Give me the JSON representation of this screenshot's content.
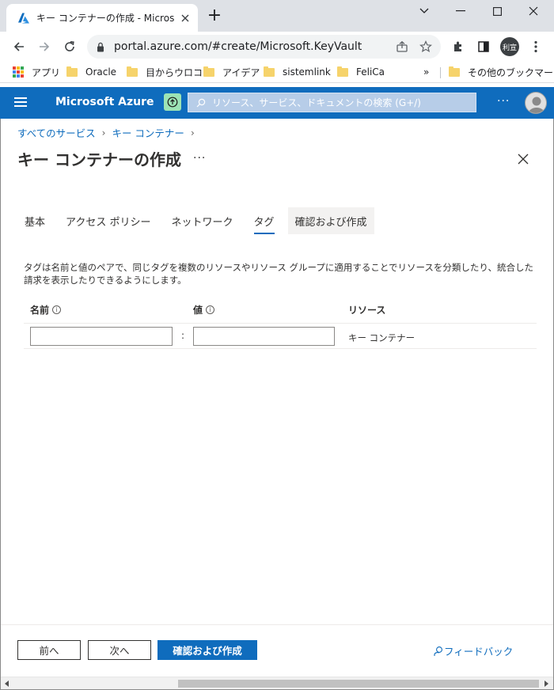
{
  "browser": {
    "tab_title": "キー コンテナーの作成 - Microsoft Az",
    "new_tab_glyph": "+",
    "url": "portal.azure.com/#create/Microsoft.KeyVault",
    "profile_initials": "利宣",
    "bookmarks": [
      {
        "label": "アプリ",
        "icon": "apps-grid-icon"
      },
      {
        "label": "Oracle",
        "icon": "folder-icon"
      },
      {
        "label": "目からウロコ",
        "icon": "folder-icon"
      },
      {
        "label": "アイデア",
        "icon": "folder-icon"
      },
      {
        "label": "sistemlink",
        "icon": "folder-icon"
      },
      {
        "label": "FeliCa",
        "icon": "folder-icon"
      }
    ],
    "bookmarks_overflow": "»",
    "other_bookmarks": "その他のブックマーク"
  },
  "azure": {
    "brand": "Microsoft Azure",
    "search_placeholder": "リソース、サービス、ドキュメントの検索 (G+/)",
    "more": "···"
  },
  "page": {
    "breadcrumb": [
      "すべてのサービス",
      "キー コンテナー"
    ],
    "title": "キー コンテナーの作成",
    "title_more": "···",
    "tabs": [
      "基本",
      "アクセス ポリシー",
      "ネットワーク",
      "タグ",
      "確認および作成"
    ],
    "active_tab": "タグ",
    "description": "タグは名前と値のペアで、同じタグを複数のリソースやリソース グループに適用することでリソースを分類したり、統合した請求を表示したりできるようにします。",
    "columns": {
      "name": "名前",
      "value": "値",
      "resource": "リソース"
    },
    "info_glyph": "i",
    "row": {
      "name_value": "",
      "value_value": "",
      "separator": ":",
      "resource": "キー コンテナー"
    }
  },
  "footer": {
    "prev": "前へ",
    "next": "次へ",
    "review_create": "確認および作成",
    "feedback": "フィードバック"
  },
  "colors": {
    "azure_blue": "#0f6cbd",
    "copilot_green": "#9ce3b5"
  }
}
